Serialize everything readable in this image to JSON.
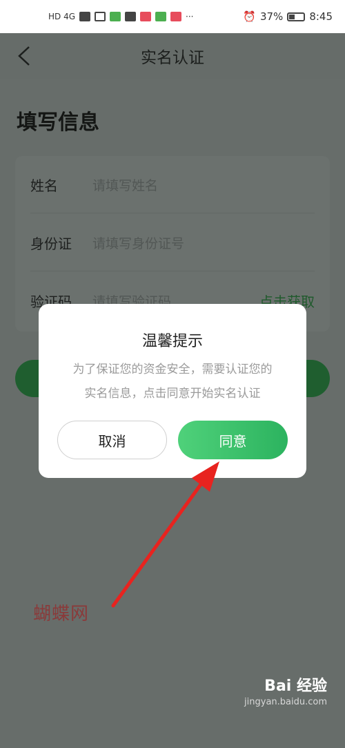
{
  "status_bar": {
    "left_text": "HD 4G",
    "more": "···",
    "battery": "37%",
    "time": "8:45"
  },
  "nav": {
    "title": "实名认证"
  },
  "form": {
    "section_title": "填写信息",
    "rows": [
      {
        "label": "姓名",
        "placeholder": "请填写姓名"
      },
      {
        "label": "身份证",
        "placeholder": "请填写身份证号"
      },
      {
        "label": "验证码",
        "placeholder": "请填写验证码",
        "action": "点击获取"
      }
    ]
  },
  "dialog": {
    "title": "温馨提示",
    "message_line1": "为了保证您的资金安全，需要认证您的",
    "message_line2": "实名信息，点击同意开始实名认证",
    "cancel_label": "取消",
    "agree_label": "同意"
  },
  "watermark": {
    "text": "蝴蝶网"
  },
  "brand": {
    "logo": "Bai 经验",
    "sub": "jingyan.baidu.com"
  },
  "colors": {
    "accent_green": "#2cb35f",
    "annotation_red": "#e8231f",
    "overlay": "#676d6a"
  }
}
